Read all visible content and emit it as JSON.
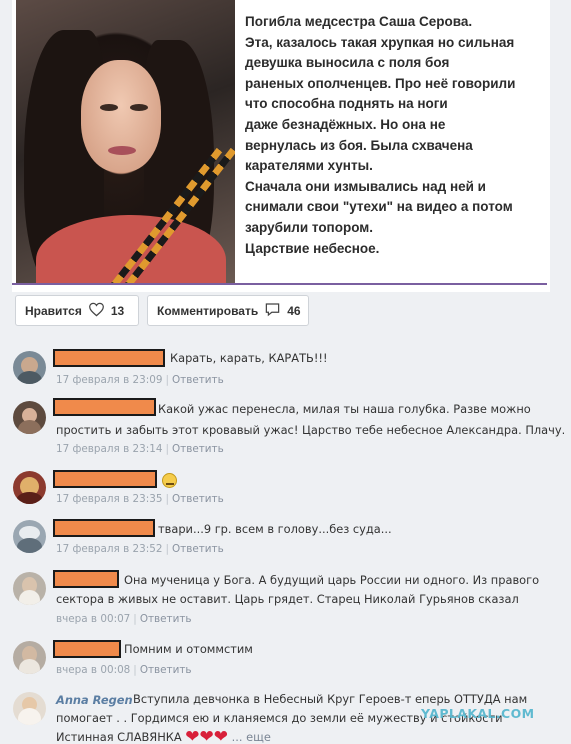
{
  "post": {
    "caption_lines": [
      "Погибла медсестра Саша Серова.",
      "Эта, казалось такая хрупкая но сильная",
      "девушка выносила с поля боя",
      "раненых ополченцев. Про неё говорили",
      "что способна поднять на ноги",
      "даже безнадёжных. Но она не",
      "вернулась из боя. Была схвачена",
      "карателями хунты.",
      "Сначала они измывались над ней и",
      "снимали свои \"утехи\" на видео а потом",
      "зарубили топором.",
      "Царствие небесное."
    ],
    "accent_color": "#7a5fa0"
  },
  "actions": {
    "like_label": "Нравится",
    "like_count": "13",
    "like_icon": "heart-outline-icon",
    "comment_label": "Комментировать",
    "comment_count": "46",
    "comment_icon": "speech-bubble-icon"
  },
  "comments": [
    {
      "text": "Карать, карать, КАРАТЬ!!!",
      "date": "17 февраля в 23:09",
      "reply": "Ответить"
    },
    {
      "text_line1": "Какой ужас перенесла, милая ты наша голубка. Разве можно",
      "text_line2": "простить и забыть этот кровавый ужас! Царство тебе небесное Александра. Плачу.",
      "date": "17 февраля в 23:14",
      "reply": "Ответить"
    },
    {
      "emoji": "sad-face-emoji",
      "date": "17 февраля в 23:35",
      "reply": "Ответить"
    },
    {
      "text": "твари...9 гр. всем в голову...без суда...",
      "date": "17 февраля в 23:52",
      "reply": "Ответить"
    },
    {
      "text_line1": "Она мученица у Бога. А будущий царь России ни одного. Из правого",
      "text_line2": "сектора в живых не оставит. Царь грядет. Старец Николай Гурьянов сказал",
      "date": "вчера в 00:07",
      "reply": "Ответить"
    },
    {
      "text": "Помним и отоммстим",
      "date": "вчера в 00:08",
      "reply": "Ответить"
    },
    {
      "author": "Anna Regen",
      "text_line1": "Вступила девчонка в Небесный Круг Героев-т еперь ОТТУДА нам",
      "text_line2": "помогает . . Гордимся ею и кланяемся до земли её мужеству и стойкости",
      "text_line3": "Истинная СЛАВЯНКА",
      "hearts": "❤❤❤",
      "more": "... еще"
    }
  ],
  "watermark": "YAPLAKAL.COM",
  "colors": {
    "redaction": "#f08a4b",
    "meta": "#9aa3ad",
    "author": "#5b7ea3",
    "watermark": "#59b8cf"
  }
}
